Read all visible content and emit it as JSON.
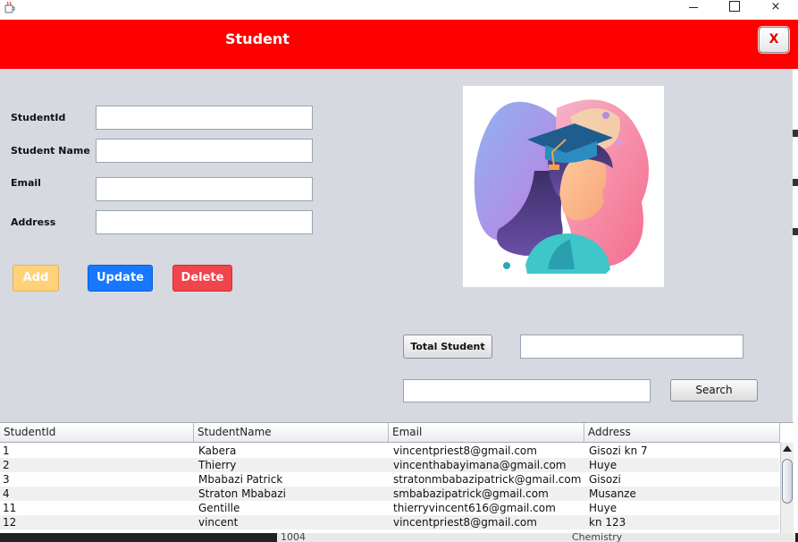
{
  "window": {
    "app_icon": "java-cup-icon",
    "minimize": "minimize-icon",
    "maximize": "maximize-icon",
    "close": "×"
  },
  "header": {
    "title": "Student",
    "close_label": "X",
    "bg_color": "#ff0000"
  },
  "form": {
    "labels": {
      "student_id": "StudentId",
      "student_name": "Student Name",
      "email": "Email",
      "address": "Address"
    },
    "values": {
      "student_id": "",
      "student_name": "",
      "email": "",
      "address": ""
    }
  },
  "actions": {
    "add": "Add",
    "update": "Update",
    "delete": "Delete"
  },
  "image": {
    "description_icon": "graduate-illustration"
  },
  "total": {
    "button_label": "Total Student",
    "value": ""
  },
  "search": {
    "value": "",
    "button_label": "Search"
  },
  "table": {
    "columns": [
      "StudentId",
      "StudentName",
      "Email",
      "Address"
    ],
    "rows": [
      [
        "1",
        "Kabera",
        "vincentpriest8@gmail.com",
        "Gisozi kn 7"
      ],
      [
        "2",
        "Thierry",
        "vincenthabayimana@gmail.com",
        "Huye"
      ],
      [
        "3",
        "Mbabazi Patrick",
        "stratonmbabazipatrick@gmail.com",
        "Gisozi"
      ],
      [
        "4",
        "Straton Mbabazi",
        "smbabazipatrick@gmail.com",
        "Musanze"
      ],
      [
        "11",
        "Gentille",
        "thierryvincent616@gmail.com",
        "Huye"
      ],
      [
        "12",
        "vincent",
        "vincentpriest8@gmail.com",
        "kn 123"
      ]
    ]
  },
  "background_window": {
    "text_left": "1004",
    "text_right": "Chemistry"
  }
}
